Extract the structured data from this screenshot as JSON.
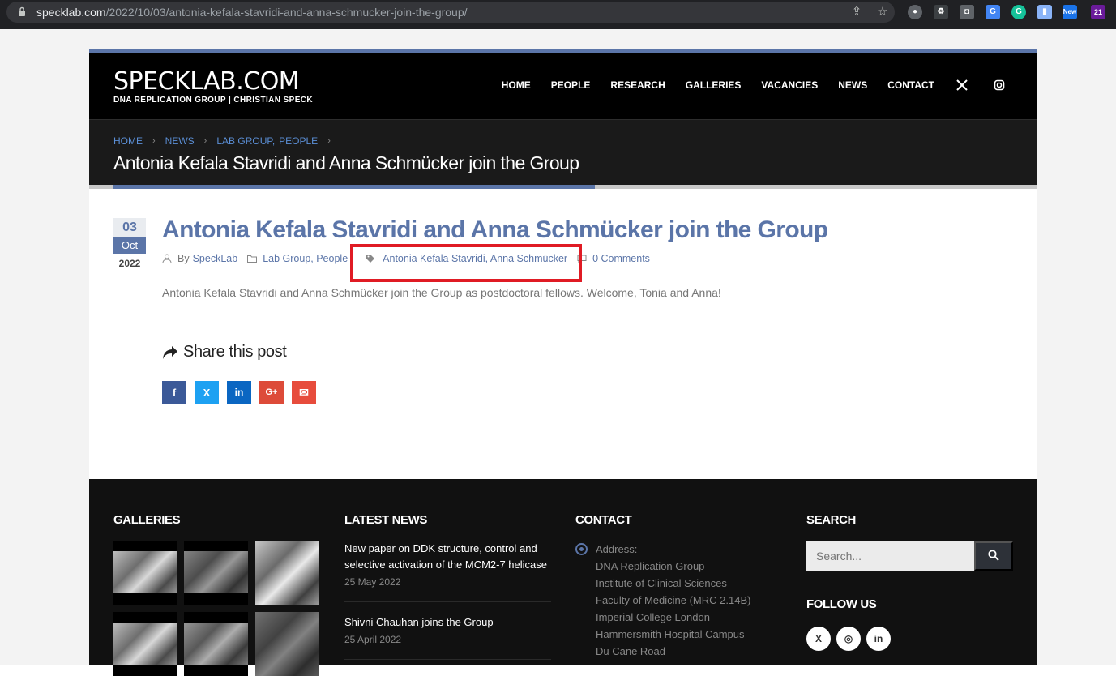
{
  "browser": {
    "url_domain": "specklab.com",
    "url_path": "/2022/10/03/antonia-kefala-stavridi-and-anna-schmucker-join-the-group/",
    "ext_new_badge": "New",
    "ext_count_badge": "21"
  },
  "header": {
    "logo_text": "SPECKLAB.COM",
    "logo_subtext": "DNA REPLICATION GROUP | CHRISTIAN SPECK",
    "nav": [
      "HOME",
      "PEOPLE",
      "RESEARCH",
      "GALLERIES",
      "VACANCIES",
      "NEWS",
      "CONTACT"
    ]
  },
  "breadcrumb": {
    "home": "HOME",
    "news": "NEWS",
    "cat1": "LAB GROUP,",
    "cat2": "PEOPLE",
    "page_title": "Antonia Kefala Stavridi and Anna Schmücker join the Group"
  },
  "post": {
    "day": "03",
    "month": "Oct",
    "year": "2022",
    "title": "Antonia Kefala Stavridi and Anna Schmücker join the Group",
    "by_label": "By",
    "author": "SpeckLab",
    "categories": "Lab Group, People",
    "tags": "Antonia Kefala Stavridi, Anna Schmücker",
    "comments": "0 Comments",
    "excerpt": "Antonia Kefala Stavridi and Anna Schmücker join the Group as postdoctoral fellows.  Welcome, Tonia and Anna!",
    "share_heading": "Share this post",
    "share_buttons": [
      "f",
      "X",
      "in",
      "G+",
      "✉"
    ]
  },
  "footer": {
    "galleries_heading": "GALLERIES",
    "news_heading": "LATEST NEWS",
    "contact_heading": "CONTACT",
    "search_heading": "SEARCH",
    "follow_heading": "FOLLOW US",
    "news": [
      {
        "title": "New paper on DDK structure, control and selective activation of the MCM2-7 helicase",
        "date": "25 May 2022"
      },
      {
        "title": "Shivni Chauhan joins the Group",
        "date": "25 April 2022"
      }
    ],
    "contact_lines": [
      "Address:",
      "DNA Replication Group",
      "Institute of Clinical Sciences",
      "Faculty of Medicine (MRC 2.14B)",
      "Imperial College London",
      "Hammersmith Hospital Campus",
      "Du Cane Road"
    ],
    "search_placeholder": "Search...",
    "follow": [
      "X",
      "◎",
      "in"
    ]
  },
  "colors": {
    "accent": "#5b75a8",
    "highlight_box": "#e01b24",
    "facebook": "#3b5998",
    "twitter": "#1da1f2",
    "linkedin": "#0a66c2",
    "googleplus": "#dd4b39",
    "email": "#e74c3c"
  }
}
